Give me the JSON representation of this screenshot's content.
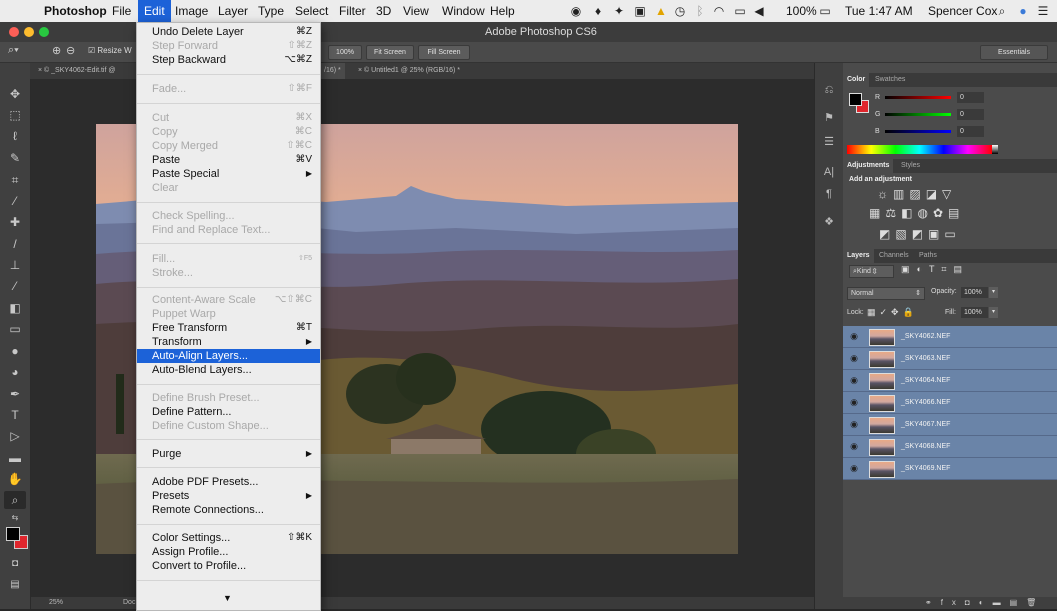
{
  "menubar": {
    "app": "Photoshop",
    "items": [
      "File",
      "Edit",
      "Image",
      "Layer",
      "Type",
      "Select",
      "Filter",
      "3D",
      "View",
      "Window",
      "Help"
    ],
    "battery": "100%",
    "clock": "Tue 1:47 AM",
    "user": "Spencer Cox"
  },
  "window": {
    "title": "Adobe Photoshop CS6"
  },
  "options": {
    "resize_label": "Resize W",
    "zoom_100": "100%",
    "fit_screen": "Fit Screen",
    "fill_screen": "Fill Screen",
    "workspace": "Essentials"
  },
  "tabs": [
    {
      "label": "© _SKY4062-Edit.tif @"
    },
    {
      "label": "/16) *"
    },
    {
      "label": "© Untitled1 @ 25% (RGB/16) *"
    }
  ],
  "status": {
    "zoom": "25%",
    "doc": "Doc: ..."
  },
  "color_panel": {
    "tabs": [
      "Color",
      "Swatches"
    ],
    "channels": [
      {
        "label": "R",
        "value": "0"
      },
      {
        "label": "G",
        "value": "0"
      },
      {
        "label": "B",
        "value": "0"
      }
    ]
  },
  "adjustments_panel": {
    "tabs": [
      "Adjustments",
      "Styles"
    ],
    "heading": "Add an adjustment"
  },
  "layers_panel": {
    "tabs": [
      "Layers",
      "Channels",
      "Paths"
    ],
    "kind": "Kind",
    "blend_mode": "Normal",
    "opacity_label": "Opacity:",
    "opacity": "100%",
    "lock_label": "Lock:",
    "fill_label": "Fill:",
    "fill": "100%",
    "layers": [
      "_SKY4062.NEF",
      "_SKY4063.NEF",
      "_SKY4064.NEF",
      "_SKY4066.NEF",
      "_SKY4067.NEF",
      "_SKY4068.NEF",
      "_SKY4069.NEF"
    ]
  },
  "edit_menu": {
    "items": [
      {
        "label": "Undo Delete Layer",
        "shortcut": "⌘Z",
        "state": "enabled"
      },
      {
        "label": "Step Forward",
        "shortcut": "⇧⌘Z",
        "state": "disabled"
      },
      {
        "label": "Step Backward",
        "shortcut": "⌥⌘Z",
        "state": "enabled"
      },
      {
        "label": "Fade...",
        "shortcut": "⇧⌘F",
        "state": "disabled"
      },
      {
        "label": "Cut",
        "shortcut": "⌘X",
        "state": "disabled"
      },
      {
        "label": "Copy",
        "shortcut": "⌘C",
        "state": "disabled"
      },
      {
        "label": "Copy Merged",
        "shortcut": "⇧⌘C",
        "state": "disabled"
      },
      {
        "label": "Paste",
        "shortcut": "⌘V",
        "state": "enabled"
      },
      {
        "label": "Paste Special",
        "shortcut": "",
        "state": "enabled",
        "submenu": true
      },
      {
        "label": "Clear",
        "shortcut": "",
        "state": "disabled"
      },
      {
        "label": "Check Spelling...",
        "shortcut": "",
        "state": "disabled"
      },
      {
        "label": "Find and Replace Text...",
        "shortcut": "",
        "state": "disabled"
      },
      {
        "label": "Fill...",
        "shortcut": "⇧F5",
        "state": "disabled"
      },
      {
        "label": "Stroke...",
        "shortcut": "",
        "state": "disabled"
      },
      {
        "label": "Content-Aware Scale",
        "shortcut": "⌥⇧⌘C",
        "state": "disabled"
      },
      {
        "label": "Puppet Warp",
        "shortcut": "",
        "state": "disabled"
      },
      {
        "label": "Free Transform",
        "shortcut": "⌘T",
        "state": "enabled"
      },
      {
        "label": "Transform",
        "shortcut": "",
        "state": "enabled",
        "submenu": true
      },
      {
        "label": "Auto-Align Layers...",
        "shortcut": "",
        "state": "highlighted"
      },
      {
        "label": "Auto-Blend Layers...",
        "shortcut": "",
        "state": "enabled"
      },
      {
        "label": "Define Brush Preset...",
        "shortcut": "",
        "state": "disabled"
      },
      {
        "label": "Define Pattern...",
        "shortcut": "",
        "state": "enabled"
      },
      {
        "label": "Define Custom Shape...",
        "shortcut": "",
        "state": "disabled"
      },
      {
        "label": "Purge",
        "shortcut": "",
        "state": "enabled",
        "submenu": true
      },
      {
        "label": "Adobe PDF Presets...",
        "shortcut": "",
        "state": "enabled"
      },
      {
        "label": "Presets",
        "shortcut": "",
        "state": "enabled",
        "submenu": true
      },
      {
        "label": "Remote Connections...",
        "shortcut": "",
        "state": "enabled"
      },
      {
        "label": "Color Settings...",
        "shortcut": "⇧⌘K",
        "state": "enabled"
      },
      {
        "label": "Assign Profile...",
        "shortcut": "",
        "state": "enabled"
      },
      {
        "label": "Convert to Profile...",
        "shortcut": "",
        "state": "enabled"
      }
    ]
  },
  "colors": {
    "menu_highlight": "#1c62d8",
    "layer_selected": "#6a84a8",
    "foreground": "#000000",
    "background": "#e0262d"
  }
}
